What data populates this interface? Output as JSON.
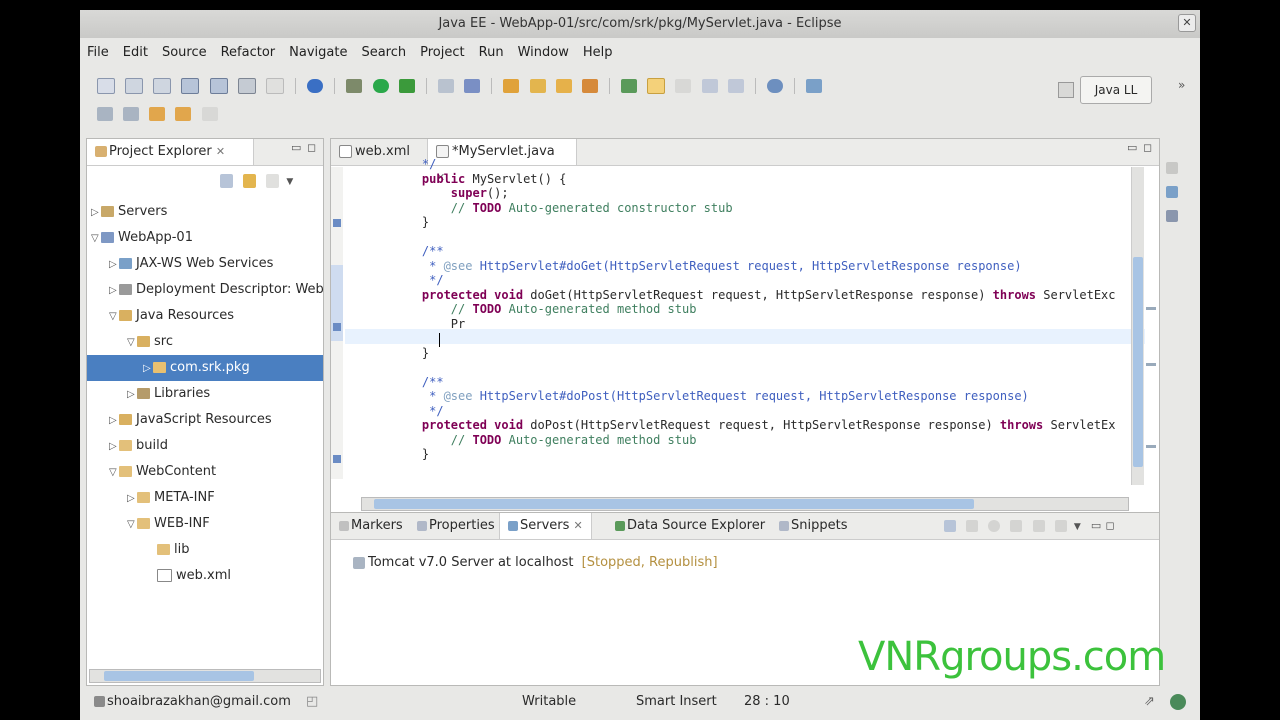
{
  "window": {
    "title": "Java EE - WebApp-01/src/com/srk/pkg/MyServlet.java - Eclipse"
  },
  "menu": [
    "File",
    "Edit",
    "Source",
    "Refactor",
    "Navigate",
    "Search",
    "Project",
    "Run",
    "Window",
    "Help"
  ],
  "perspective": {
    "label": "Java LL"
  },
  "explorer": {
    "tab_label": "Project Explorer",
    "items": [
      {
        "label": "Servers",
        "depth": 0,
        "twisty": "closed",
        "icon": "folder-icon"
      },
      {
        "label": "WebApp-01",
        "depth": 0,
        "twisty": "open",
        "icon": "project-icon"
      },
      {
        "label": "JAX-WS Web Services",
        "depth": 1,
        "twisty": "closed",
        "icon": "webservice-icon"
      },
      {
        "label": "Deployment Descriptor: Web",
        "depth": 1,
        "twisty": "closed",
        "icon": "descriptor-icon"
      },
      {
        "label": "Java Resources",
        "depth": 1,
        "twisty": "open",
        "icon": "folder-icon"
      },
      {
        "label": "src",
        "depth": 2,
        "twisty": "open",
        "icon": "source-folder-icon"
      },
      {
        "label": "com.srk.pkg",
        "depth": 3,
        "twisty": "closed",
        "icon": "package-icon",
        "selected": true
      },
      {
        "label": "Libraries",
        "depth": 2,
        "twisty": "closed",
        "icon": "library-icon"
      },
      {
        "label": "JavaScript Resources",
        "depth": 1,
        "twisty": "closed",
        "icon": "folder-icon"
      },
      {
        "label": "build",
        "depth": 1,
        "twisty": "closed",
        "icon": "folder-icon"
      },
      {
        "label": "WebContent",
        "depth": 1,
        "twisty": "open",
        "icon": "folder-icon"
      },
      {
        "label": "META-INF",
        "depth": 2,
        "twisty": "closed",
        "icon": "folder-icon"
      },
      {
        "label": "WEB-INF",
        "depth": 2,
        "twisty": "open",
        "icon": "folder-icon"
      },
      {
        "label": "lib",
        "depth": 3,
        "twisty": "none",
        "icon": "folder-icon"
      },
      {
        "label": "web.xml",
        "depth": 3,
        "twisty": "none",
        "icon": "xml-file-icon"
      }
    ]
  },
  "editor": {
    "tabs": [
      {
        "label": "web.xml"
      },
      {
        "label": "*MyServlet.java"
      }
    ],
    "lines": [
      {
        "parts": [
          {
            "t": "    */",
            "c": "cm"
          }
        ]
      },
      {
        "parts": [
          {
            "t": "    ",
            "c": ""
          },
          {
            "t": "public",
            "c": "kw"
          },
          {
            "t": " MyServlet() {",
            "c": ""
          }
        ]
      },
      {
        "parts": [
          {
            "t": "        ",
            "c": ""
          },
          {
            "t": "super",
            "c": "kw"
          },
          {
            "t": "();",
            "c": ""
          }
        ]
      },
      {
        "parts": [
          {
            "t": "        ",
            "c": ""
          },
          {
            "t": "// ",
            "c": "lc"
          },
          {
            "t": "TODO",
            "c": "kw"
          },
          {
            "t": " Auto-generated constructor stub",
            "c": "lc"
          }
        ]
      },
      {
        "parts": [
          {
            "t": "    }",
            "c": ""
          }
        ]
      },
      {
        "parts": [
          {
            "t": "",
            "c": ""
          }
        ]
      },
      {
        "parts": [
          {
            "t": "    /**",
            "c": "cm"
          }
        ]
      },
      {
        "parts": [
          {
            "t": "     * ",
            "c": "cm"
          },
          {
            "t": "@see",
            "c": "tc"
          },
          {
            "t": " HttpServlet#doGet(HttpServletRequest request, HttpServletResponse response)",
            "c": "cm"
          }
        ]
      },
      {
        "parts": [
          {
            "t": "     */",
            "c": "cm"
          }
        ]
      },
      {
        "parts": [
          {
            "t": "    ",
            "c": ""
          },
          {
            "t": "protected void",
            "c": "kw"
          },
          {
            "t": " doGet(HttpServletRequest request, HttpServletResponse response) ",
            "c": ""
          },
          {
            "t": "throws",
            "c": "kw"
          },
          {
            "t": " ServletExc",
            "c": ""
          }
        ]
      },
      {
        "parts": [
          {
            "t": "        ",
            "c": ""
          },
          {
            "t": "// ",
            "c": "lc"
          },
          {
            "t": "TODO",
            "c": "kw"
          },
          {
            "t": " Auto-generated method stub",
            "c": "lc"
          }
        ]
      },
      {
        "parts": [
          {
            "t": "        Pr",
            "c": ""
          }
        ]
      },
      {
        "parts": [
          {
            "t": "",
            "c": ""
          }
        ]
      },
      {
        "parts": [
          {
            "t": "    }",
            "c": ""
          }
        ]
      },
      {
        "parts": [
          {
            "t": "",
            "c": ""
          }
        ]
      },
      {
        "parts": [
          {
            "t": "    /**",
            "c": "cm"
          }
        ]
      },
      {
        "parts": [
          {
            "t": "     * ",
            "c": "cm"
          },
          {
            "t": "@see",
            "c": "tc"
          },
          {
            "t": " HttpServlet#doPost(HttpServletRequest request, HttpServletResponse response)",
            "c": "cm"
          }
        ]
      },
      {
        "parts": [
          {
            "t": "     */",
            "c": "cm"
          }
        ]
      },
      {
        "parts": [
          {
            "t": "    ",
            "c": ""
          },
          {
            "t": "protected void",
            "c": "kw"
          },
          {
            "t": " doPost(HttpServletRequest request, HttpServletResponse response) ",
            "c": ""
          },
          {
            "t": "throws",
            "c": "kw"
          },
          {
            "t": " ServletEx",
            "c": ""
          }
        ]
      },
      {
        "parts": [
          {
            "t": "        ",
            "c": ""
          },
          {
            "t": "// ",
            "c": "lc"
          },
          {
            "t": "TODO",
            "c": "kw"
          },
          {
            "t": " Auto-generated method stub",
            "c": "lc"
          }
        ]
      },
      {
        "parts": [
          {
            "t": "    }",
            "c": ""
          }
        ]
      }
    ]
  },
  "bottom": {
    "tabs": [
      {
        "label": "Markers"
      },
      {
        "label": "Properties"
      },
      {
        "label": "Servers",
        "active": true
      },
      {
        "label": "Data Source Explorer"
      },
      {
        "label": "Snippets"
      }
    ],
    "server_name": "Tomcat v7.0 Server at localhost",
    "server_state": "[Stopped, Republish]"
  },
  "status": {
    "user": "shoaibrazakhan@gmail.com",
    "mode": "Writable",
    "insert": "Smart Insert",
    "position": "28 : 10"
  },
  "watermark": "VNRgroups.com",
  "colors": {
    "keyword": "#7f0055",
    "javadoc": "#3f5fbf",
    "comment": "#3f7f5f",
    "selection": "#4a7fc1",
    "watermark": "#3cc23c"
  }
}
